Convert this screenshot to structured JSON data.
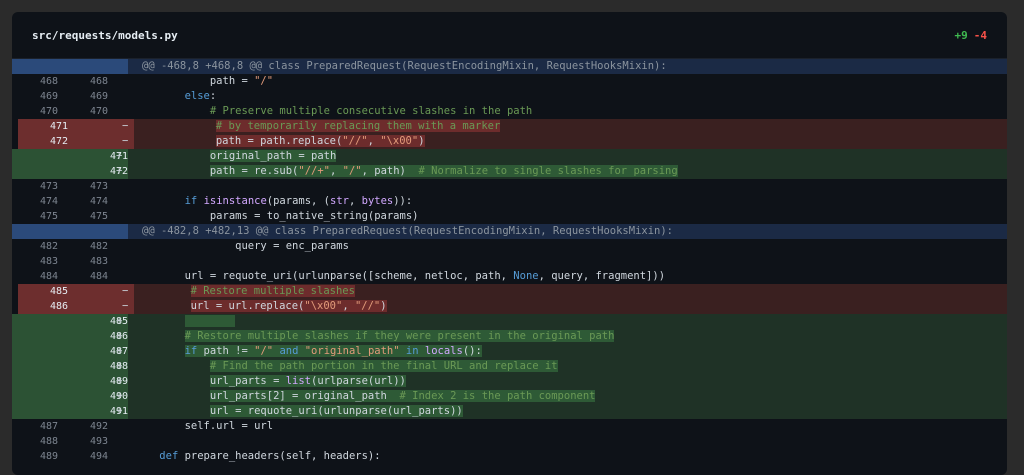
{
  "file": {
    "name": "src/requests/models.py",
    "additions": "+9",
    "deletions": "-4"
  },
  "rows": [
    {
      "type": "hunk",
      "old": "",
      "new": "",
      "sign": "",
      "text": "@@ -468,8 +468,8 @@ class PreparedRequest(RequestEncodingMixin, RequestHooksMixin):"
    },
    {
      "type": "ctx",
      "old": "468",
      "new": "468",
      "sign": "",
      "text": "            path = \"/\""
    },
    {
      "type": "ctx",
      "old": "469",
      "new": "469",
      "sign": "",
      "text": "        else:"
    },
    {
      "type": "ctx",
      "old": "470",
      "new": "470",
      "sign": "",
      "text": "            # Preserve multiple consecutive slashes in the path"
    },
    {
      "type": "del",
      "old": "471",
      "new": "",
      "sign": "−",
      "text": "            # by temporarily replacing them with a marker"
    },
    {
      "type": "del",
      "old": "472",
      "new": "",
      "sign": "−",
      "text": "            path = path.replace(\"//\", \"\\x00\")"
    },
    {
      "type": "add",
      "old": "",
      "new": "471",
      "sign": "+",
      "text": "            original_path = path"
    },
    {
      "type": "add",
      "old": "",
      "new": "472",
      "sign": "+",
      "text": "            path = re.sub(\"//+\", \"/\", path)  # Normalize to single slashes for parsing"
    },
    {
      "type": "ctx",
      "old": "473",
      "new": "473",
      "sign": "",
      "text": ""
    },
    {
      "type": "ctx",
      "old": "474",
      "new": "474",
      "sign": "",
      "text": "        if isinstance(params, (str, bytes)):"
    },
    {
      "type": "ctx",
      "old": "475",
      "new": "475",
      "sign": "",
      "text": "            params = to_native_string(params)"
    },
    {
      "type": "hunk",
      "old": "",
      "new": "",
      "sign": "",
      "text": "@@ -482,8 +482,13 @@ class PreparedRequest(RequestEncodingMixin, RequestHooksMixin):"
    },
    {
      "type": "ctx",
      "old": "482",
      "new": "482",
      "sign": "",
      "text": "                query = enc_params"
    },
    {
      "type": "ctx",
      "old": "483",
      "new": "483",
      "sign": "",
      "text": ""
    },
    {
      "type": "ctx",
      "old": "484",
      "new": "484",
      "sign": "",
      "text": "        url = requote_uri(urlunparse([scheme, netloc, path, None, query, fragment]))"
    },
    {
      "type": "del",
      "old": "485",
      "new": "",
      "sign": "−",
      "text": "        # Restore multiple slashes"
    },
    {
      "type": "del",
      "old": "486",
      "new": "",
      "sign": "−",
      "text": "        url = url.replace(\"\\x00\", \"//\")"
    },
    {
      "type": "add",
      "old": "",
      "new": "485",
      "sign": "+",
      "text": "        "
    },
    {
      "type": "add",
      "old": "",
      "new": "486",
      "sign": "+",
      "text": "        # Restore multiple slashes if they were present in the original path"
    },
    {
      "type": "add",
      "old": "",
      "new": "487",
      "sign": "+",
      "text": "        if path != \"/\" and \"original_path\" in locals():"
    },
    {
      "type": "add",
      "old": "",
      "new": "488",
      "sign": "+",
      "text": "            # Find the path portion in the final URL and replace it"
    },
    {
      "type": "add",
      "old": "",
      "new": "489",
      "sign": "+",
      "text": "            url_parts = list(urlparse(url))"
    },
    {
      "type": "add",
      "old": "",
      "new": "490",
      "sign": "+",
      "text": "            url_parts[2] = original_path  # Index 2 is the path component"
    },
    {
      "type": "add",
      "old": "",
      "new": "491",
      "sign": "+",
      "text": "            url = requote_uri(urlunparse(url_parts))"
    },
    {
      "type": "ctx",
      "old": "487",
      "new": "492",
      "sign": "",
      "text": "        self.url = url"
    },
    {
      "type": "ctx",
      "old": "488",
      "new": "493",
      "sign": "",
      "text": ""
    },
    {
      "type": "ctx",
      "old": "489",
      "new": "494",
      "sign": "",
      "text": "    def prepare_headers(self, headers):"
    }
  ]
}
